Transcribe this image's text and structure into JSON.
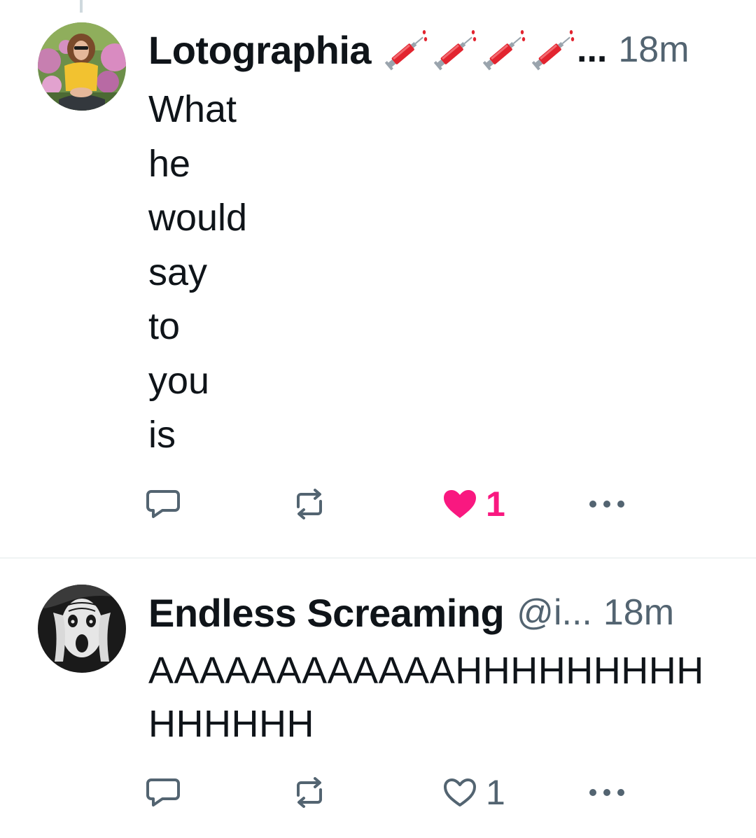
{
  "colors": {
    "text_primary": "#0f1419",
    "text_secondary": "#536471",
    "like_pink": "#f91880",
    "divider": "#eff3f4",
    "thread_line": "#cfd9de"
  },
  "tweets": [
    {
      "display_name": "Lotographia",
      "name_emoji": [
        "syringe-emoji",
        "syringe-emoji",
        "syringe-emoji",
        "syringe-emoji"
      ],
      "name_truncation": "...",
      "timestamp": "18m",
      "body_lines": [
        "What",
        "he",
        "would",
        "say",
        "to",
        "you",
        "is"
      ],
      "avatar": "profile-photo-person-in-yellow-shirt",
      "actions": {
        "reply_icon": "reply-icon",
        "retweet_icon": "retweet-icon",
        "like_icon": "heart-filled-icon",
        "like_count": "1",
        "liked": true,
        "more_icon": "more-icon"
      }
    },
    {
      "display_name": "Endless Screaming",
      "handle": "@i...",
      "timestamp": "18m",
      "body": "AAAAAAAAAAAAHHHHHHHHHHHHHHH",
      "avatar": "profile-photo-the-scream",
      "actions": {
        "reply_icon": "reply-icon",
        "retweet_icon": "retweet-icon",
        "like_icon": "heart-outline-icon",
        "like_count": "1",
        "liked": false,
        "more_icon": "more-icon"
      }
    }
  ]
}
